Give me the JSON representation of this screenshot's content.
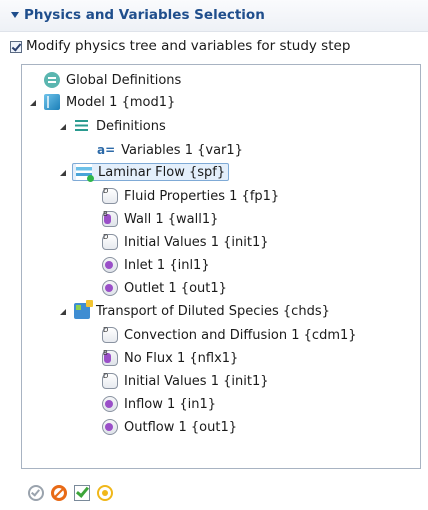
{
  "section": {
    "title": "Physics and Variables Selection",
    "modify_checkbox": {
      "label": "Modify physics tree and variables for study step",
      "checked": true
    }
  },
  "tree": {
    "global_definitions": {
      "label": "Global Definitions",
      "icon": "global-definitions-icon"
    },
    "model": {
      "label": "Model 1 {mod1}",
      "icon": "model-icon",
      "expanded": true,
      "definitions": {
        "label": "Definitions",
        "icon": "definitions-icon",
        "expanded": true,
        "variables": {
          "prefix": "a=",
          "label": "Variables 1 {var1}"
        }
      },
      "laminar_flow": {
        "label": "Laminar Flow {spf}",
        "icon": "laminar-flow-icon",
        "expanded": true,
        "selected": true,
        "children": [
          {
            "label": "Fluid Properties 1 {fp1}",
            "icon": "domain-feature-icon"
          },
          {
            "label": "Wall 1 {wall1}",
            "icon": "boundary-feature-icon"
          },
          {
            "label": "Initial Values 1 {init1}",
            "icon": "domain-feature-icon"
          },
          {
            "label": "Inlet 1 {inl1}",
            "icon": "inflow-feature-icon"
          },
          {
            "label": "Outlet 1 {out1}",
            "icon": "inflow-feature-icon"
          }
        ]
      },
      "transport": {
        "label": "Transport of Diluted Species {chds}",
        "icon": "transport-species-icon",
        "expanded": true,
        "children": [
          {
            "label": "Convection and Diffusion 1 {cdm1}",
            "icon": "domain-feature-icon"
          },
          {
            "label": "No Flux 1 {nflx1}",
            "icon": "boundary-feature-icon"
          },
          {
            "label": "Initial Values 1 {init1}",
            "icon": "domain-feature-icon"
          },
          {
            "label": "Inflow 1 {in1}",
            "icon": "inflow-feature-icon"
          },
          {
            "label": "Outflow 1 {out1}",
            "icon": "inflow-feature-icon"
          }
        ]
      }
    }
  },
  "toolbar": {
    "buttons": [
      {
        "icon": "show-default-icon",
        "color": "#9aa3ad"
      },
      {
        "icon": "disable-icon",
        "color": "#e86a16"
      },
      {
        "icon": "enable-icon",
        "color": "#3da53a"
      },
      {
        "icon": "reset-icon",
        "color": "#f0b71a"
      }
    ]
  },
  "colors": {
    "accent": "#1f4e8c",
    "selection_bg": "#e4effb",
    "selection_border": "#7faad6"
  }
}
